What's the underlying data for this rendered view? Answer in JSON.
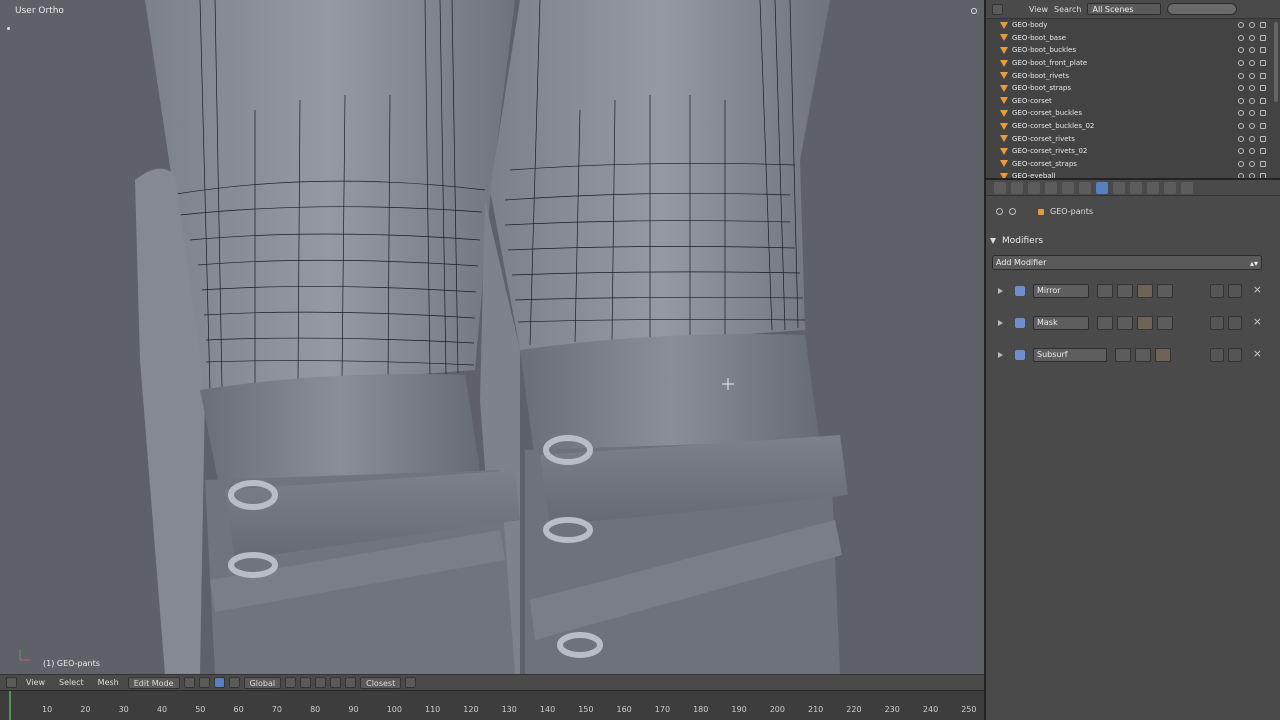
{
  "viewport": {
    "title": "User Ortho",
    "object_label": "(1) GEO-pants"
  },
  "viewport_header": {
    "menus": [
      "View",
      "Select",
      "Mesh"
    ],
    "mode": "Edit Mode",
    "pivot": "Global",
    "snap": "Closest"
  },
  "timeline": {
    "ticks": [
      "10",
      "20",
      "30",
      "40",
      "50",
      "60",
      "70",
      "80",
      "90",
      "100",
      "110",
      "120",
      "130",
      "140",
      "150",
      "160",
      "170",
      "180",
      "190",
      "200",
      "210",
      "220",
      "230",
      "240",
      "250"
    ]
  },
  "outliner": {
    "menus": [
      "View",
      "Search"
    ],
    "scene_select": "All Scenes",
    "items": [
      "GEO-body",
      "GEO-boot_base",
      "GEO-boot_buckles",
      "GEO-boot_front_plate",
      "GEO-boot_rivets",
      "GEO-boot_straps",
      "GEO-corset",
      "GEO-corset_buckles",
      "GEO-corset_buckles_02",
      "GEO-corset_rivets",
      "GEO-corset_rivets_02",
      "GEO-corset_straps",
      "GEO-eyeball"
    ]
  },
  "properties": {
    "object_name": "GEO-pants",
    "panel_title": "Modifiers",
    "add_modifier": "Add Modifier",
    "modifiers": [
      "Mirror",
      "Mask",
      "Subsurf"
    ]
  },
  "colors": {
    "accent_blue": "#5680c2",
    "object_orange": "#e89a3c",
    "viewport_bg": "#5e6268"
  }
}
